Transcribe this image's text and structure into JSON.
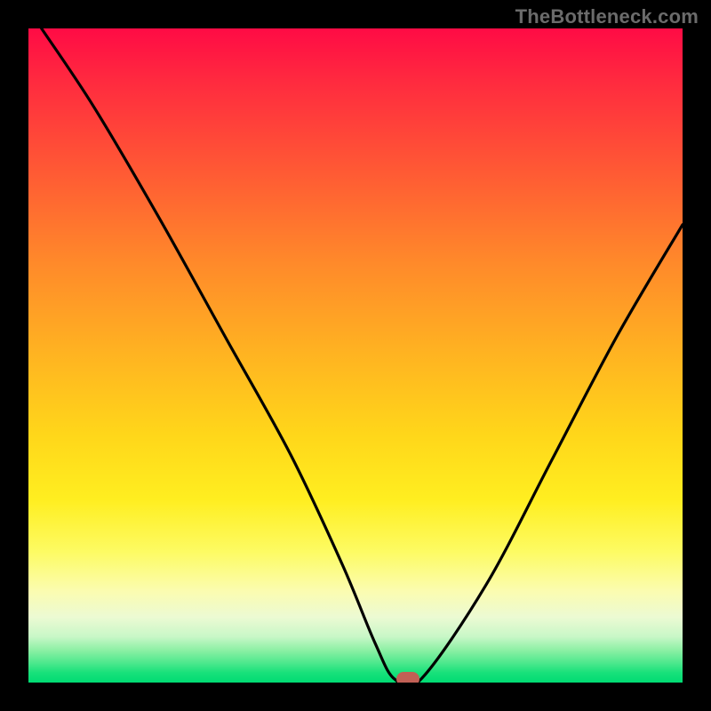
{
  "watermark": "TheBottleneck.com",
  "chart_data": {
    "type": "line",
    "title": "",
    "xlabel": "",
    "ylabel": "",
    "xlim": [
      0,
      100
    ],
    "ylim": [
      0,
      100
    ],
    "grid": false,
    "series": [
      {
        "name": "bottleneck-curve",
        "x": [
          2,
          10,
          20,
          30,
          40,
          48,
          53,
          56,
          60,
          70,
          80,
          90,
          100
        ],
        "values": [
          100,
          88,
          71,
          53,
          35,
          18,
          6,
          0.5,
          0.5,
          15,
          34,
          53,
          70
        ]
      }
    ],
    "marker": {
      "x": 58,
      "y": 0.5
    },
    "background_gradient": {
      "top": "#ff0b45",
      "upper_mid": "#ffb421",
      "lower_mid": "#fdfb63",
      "bottom": "#00db73"
    }
  }
}
